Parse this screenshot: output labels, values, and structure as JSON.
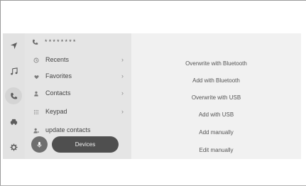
{
  "phone": {
    "masked_number": "********"
  },
  "menu": {
    "items": [
      {
        "label": "Recents",
        "icon": "recents-icon",
        "chevron": "›"
      },
      {
        "label": "Favorites",
        "icon": "heart-icon",
        "chevron": "›"
      },
      {
        "label": "Contacts",
        "icon": "contacts-icon",
        "chevron": "›"
      },
      {
        "label": "Keypad",
        "icon": "keypad-icon",
        "chevron": "›"
      },
      {
        "label": "update contacts",
        "icon": "update-contacts-icon"
      }
    ],
    "devices_label": "Devices"
  },
  "options": [
    "Overwrite with Bluetooth",
    "Add with Bluetooth",
    "Overwrite with USB",
    "Add with USB",
    "Add manually",
    "Edit manually"
  ],
  "rail": [
    "navigation-icon",
    "music-icon",
    "phone-icon",
    "car-icon",
    "settings-icon"
  ]
}
